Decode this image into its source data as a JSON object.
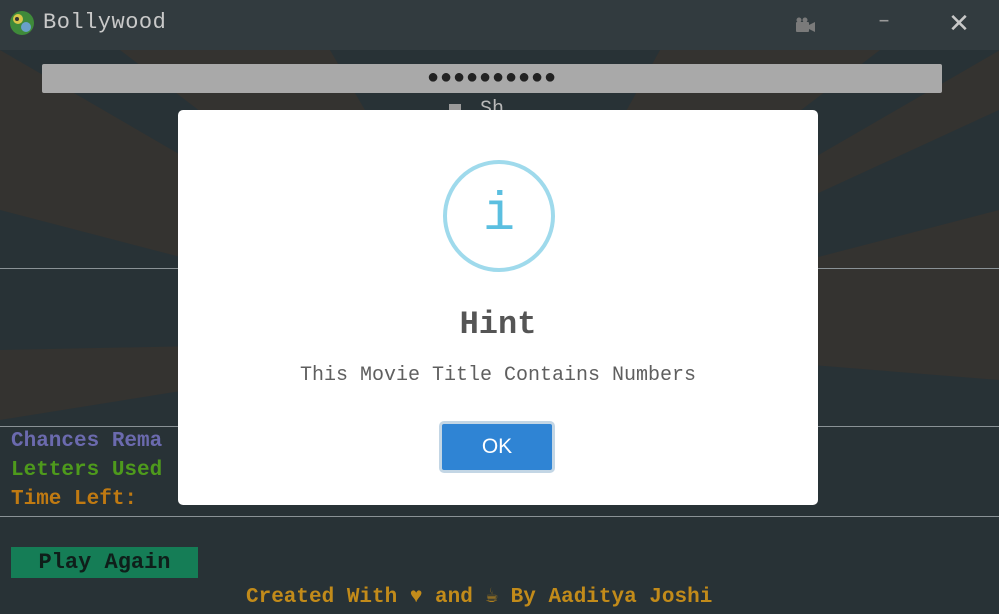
{
  "window": {
    "title": "Bollywood",
    "minimize_label": "–",
    "close_label": "✕"
  },
  "game": {
    "hidden_title": "●●●●●●●●●●",
    "show_label": "Sh",
    "chances_label": "Chances Rema",
    "letters_label": "Letters Used",
    "time_label": "Time Left:",
    "play_again_label": "Play Again",
    "footer_text": "Created With ♥ and ☕ By Aaditya Joshi"
  },
  "colors": {
    "chances": "#6b6aae",
    "letters": "#4e9a1c",
    "time": "#c07a12",
    "accent_button": "#2f84d4",
    "play_button": "#157d56"
  },
  "dialog": {
    "icon": "info-icon",
    "icon_glyph": "i",
    "title": "Hint",
    "message": "This Movie Title Contains Numbers",
    "ok_label": "OK"
  }
}
